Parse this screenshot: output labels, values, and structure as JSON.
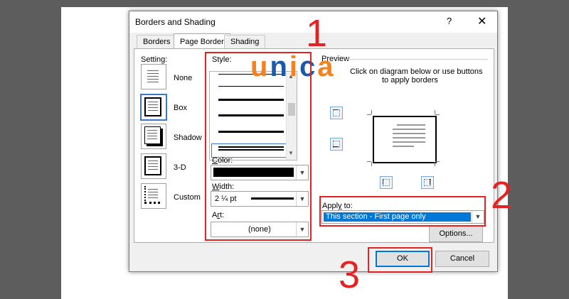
{
  "dialog": {
    "title": "Borders and Shading",
    "help": "?",
    "close": "✕",
    "tabs": [
      {
        "label": "Borders"
      },
      {
        "label": "Page Border",
        "active": true
      },
      {
        "label": "Shading"
      }
    ]
  },
  "setting": {
    "label": "Setting:",
    "items": [
      {
        "label": "None"
      },
      {
        "label": "Box",
        "selected": true
      },
      {
        "label": "Shadow"
      },
      {
        "label": "3-D"
      },
      {
        "label": "Custom"
      }
    ]
  },
  "style": {
    "label": "Style:"
  },
  "color": {
    "label": "Color:",
    "value_color": "#000000"
  },
  "width": {
    "label": "Width:",
    "value": "2 ¼ pt"
  },
  "art": {
    "label": "Art:",
    "value": "(none)"
  },
  "preview": {
    "label": "Preview",
    "hint_line1": "Click on diagram below or use buttons",
    "hint_line2": "to apply borders"
  },
  "apply_to": {
    "label": "Apply to:",
    "value": "This section - First page only"
  },
  "buttons": {
    "options": "Options...",
    "ok": "OK",
    "cancel": "Cancel"
  },
  "annotations": {
    "n1": "1",
    "n2": "2",
    "n3": "3",
    "color": "#e52222"
  },
  "watermark": {
    "text": "unica"
  }
}
